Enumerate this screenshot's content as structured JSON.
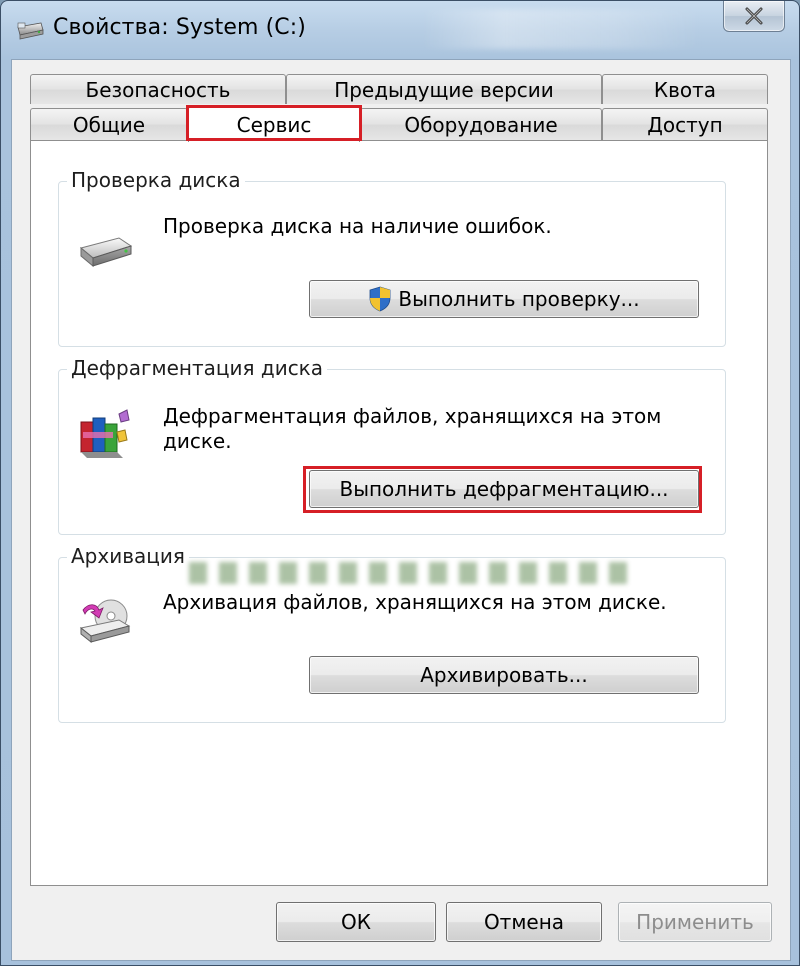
{
  "window": {
    "title": "Свойства: System (C:)",
    "close_label": "✕"
  },
  "tabs": {
    "row_top": [
      {
        "label": "Безопасность"
      },
      {
        "label": "Предыдущие версии"
      },
      {
        "label": "Квота"
      }
    ],
    "row_bottom": [
      {
        "label": "Общие"
      },
      {
        "label": "Сервис",
        "active": true
      },
      {
        "label": "Оборудование"
      },
      {
        "label": "Доступ"
      }
    ]
  },
  "groups": {
    "check": {
      "title": "Проверка диска",
      "description": "Проверка диска на наличие ошибок.",
      "button": "Выполнить проверку..."
    },
    "defrag": {
      "title": "Дефрагментация диска",
      "description": "Дефрагментация файлов, хранящихся на этом диске.",
      "button": "Выполнить дефрагментацию..."
    },
    "backup": {
      "title": "Архивация",
      "description": "Архивация файлов, хранящихся на этом диске.",
      "button": "Архивировать..."
    }
  },
  "footer": {
    "ok": "ОК",
    "cancel": "Отмена",
    "apply": "Применить"
  },
  "colors": {
    "highlight": "#d61f26",
    "shield_blue": "#2f6fc8",
    "shield_yellow": "#f2c230"
  },
  "icons": {
    "title": "drive-icon",
    "check": "hard-drive-icon",
    "defrag": "defrag-icon",
    "backup": "backup-icon",
    "check_button": "uac-shield-icon"
  }
}
